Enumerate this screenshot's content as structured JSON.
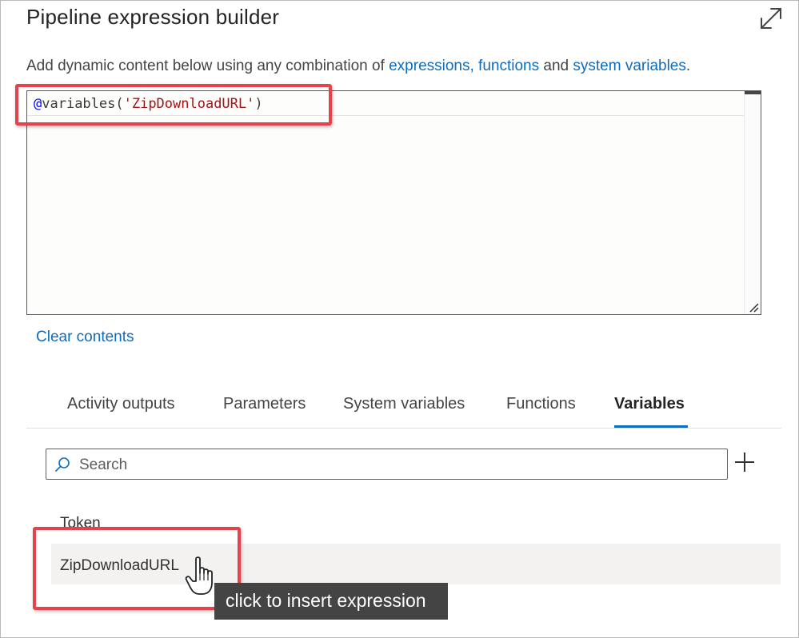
{
  "dialog": {
    "title": "Pipeline expression builder",
    "expand_icon": "expand-icon"
  },
  "description": {
    "prefix": "Add dynamic content below using any combination of ",
    "link_expressions": "expressions, functions",
    "middle": " and ",
    "link_system_variables": "system variables",
    "suffix": "."
  },
  "editor": {
    "code_at": "@",
    "code_fn": "variables(",
    "code_str": "'ZipDownloadURL'",
    "code_close": ")"
  },
  "clear_contents": "Clear contents",
  "tabs": [
    {
      "label": "Activity outputs",
      "active": false
    },
    {
      "label": "Parameters",
      "active": false
    },
    {
      "label": "System variables",
      "active": false
    },
    {
      "label": "Functions",
      "active": false
    },
    {
      "label": "Variables",
      "active": true
    }
  ],
  "search": {
    "placeholder": "Search",
    "icon": "search-icon"
  },
  "add_icon": "plus-icon",
  "variables": [
    {
      "name": "Token"
    },
    {
      "name": "ZipDownloadURL"
    }
  ],
  "tooltip": "click to insert expression",
  "colors": {
    "accent": "#0f6cbd",
    "highlight_border": "#e5434b",
    "tooltip_bg": "#444444",
    "hover_row": "#f3f2f1"
  }
}
